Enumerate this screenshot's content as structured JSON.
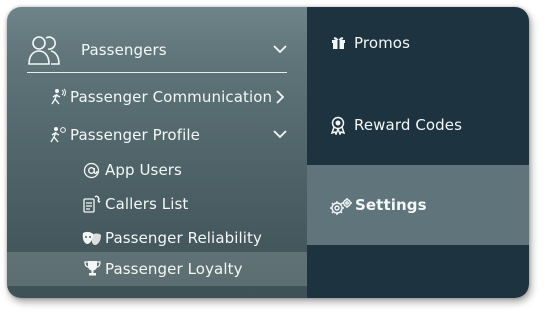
{
  "left_menu": {
    "passengers": {
      "label": "Passengers",
      "icon": "users-icon",
      "chevron": "chevron-down-icon"
    },
    "items": [
      {
        "label": "Passenger Communication",
        "icon": "person-signal-icon",
        "chevron": "chevron-right-icon"
      },
      {
        "label": "Passenger Profile",
        "icon": "person-gear-icon",
        "chevron": "chevron-down-icon"
      }
    ],
    "sub_items": [
      {
        "label": "App Users",
        "icon": "at-sign-icon"
      },
      {
        "label": "Callers List",
        "icon": "phone-list-icon"
      },
      {
        "label": "Passenger Reliability",
        "icon": "masks-icon"
      },
      {
        "label": "Passenger Loyalty",
        "icon": "trophy-icon"
      }
    ]
  },
  "right_menu": {
    "items": [
      {
        "label": "Promos",
        "icon": "gift-icon"
      },
      {
        "label": "Reward Codes",
        "icon": "ribbon-icon"
      },
      {
        "label": "Settings",
        "icon": "gears-icon"
      }
    ]
  },
  "colors": {
    "left_bg": "#53686d",
    "right_bg": "#1e3340",
    "selected_bg": "#5f757b",
    "text": "#f4f7f7"
  }
}
